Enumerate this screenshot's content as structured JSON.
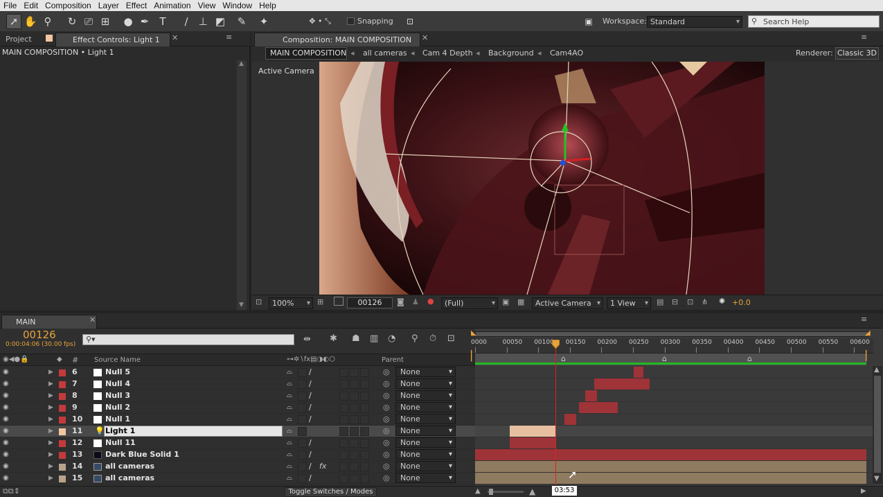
{
  "menu": [
    "File",
    "Edit",
    "Composition",
    "Layer",
    "Effect",
    "Animation",
    "View",
    "Window",
    "Help"
  ],
  "toolbar": {
    "snapping_label": "Snapping",
    "workspace_label": "Workspace:",
    "workspace_value": "Standard",
    "search_placeholder": "Search Help"
  },
  "left_panel": {
    "tab_project": "Project",
    "tab_effect_controls": "Effect Controls: Light 1",
    "breadcrumb": "MAIN COMPOSITION • Light 1"
  },
  "comp_panel": {
    "tab": "Composition: MAIN COMPOSITION",
    "crumbs": [
      "MAIN COMPOSITION",
      "all cameras",
      "Cam 4 Depth",
      "Background",
      "Cam4AO"
    ],
    "renderer_label": "Renderer:",
    "renderer_value": "Classic 3D",
    "view_label": "Active Camera",
    "footer": {
      "zoom": "100%",
      "timecode": "00126",
      "resolution": "(Full)",
      "camera": "Active Camera",
      "views": "1 View",
      "exposure": "+0.0"
    }
  },
  "timeline": {
    "tab": "MAIN COMPOSITION",
    "timecode": "00126",
    "timecode_sub": "0:00:04:06 (30.00 fps)",
    "columns": {
      "number": "#",
      "source_name": "Source Name",
      "parent": "Parent"
    },
    "ruler_ticks": [
      "0000",
      "00050",
      "00100",
      "00150",
      "00200",
      "00250",
      "00300",
      "00350",
      "00400",
      "00450",
      "00500",
      "00550",
      "00600"
    ],
    "current_time_tooltip": "03:53",
    "toggle_label": "Toggle Switches / Modes",
    "layers": [
      {
        "num": "6",
        "name": "Null 5",
        "parent": "None",
        "label_color": "#c43a3a",
        "type": "null"
      },
      {
        "num": "7",
        "name": "Null 4",
        "parent": "None",
        "label_color": "#c43a3a",
        "type": "null"
      },
      {
        "num": "8",
        "name": "Null 3",
        "parent": "None",
        "label_color": "#c43a3a",
        "type": "null"
      },
      {
        "num": "9",
        "name": "Null 2",
        "parent": "None",
        "label_color": "#c43a3a",
        "type": "null"
      },
      {
        "num": "10",
        "name": "Null 1",
        "parent": "None",
        "label_color": "#c43a3a",
        "type": "null"
      },
      {
        "num": "11",
        "name": "Light 1",
        "parent": "None",
        "label_color": "#f2c6a0",
        "type": "light",
        "selected": true
      },
      {
        "num": "12",
        "name": "Null 11",
        "parent": "None",
        "label_color": "#c43a3a",
        "type": "null"
      },
      {
        "num": "13",
        "name": "Dark Blue Solid 1",
        "parent": "None",
        "label_color": "#c43a3a",
        "type": "solid"
      },
      {
        "num": "14",
        "name": "all cameras",
        "parent": "None",
        "label_color": "#b8a38a",
        "type": "comp",
        "fx": "fx"
      },
      {
        "num": "15",
        "name": "all cameras",
        "parent": "None",
        "label_color": "#b8a38a",
        "type": "comp"
      }
    ]
  },
  "colors": {
    "accent_orange": "#e8a33a",
    "playhead": "#e02020",
    "null_bar": "#9e3338",
    "light_bar": "#e6c0a0",
    "comp_bar": "#8f7b60",
    "work_area_green": "#22b822"
  }
}
